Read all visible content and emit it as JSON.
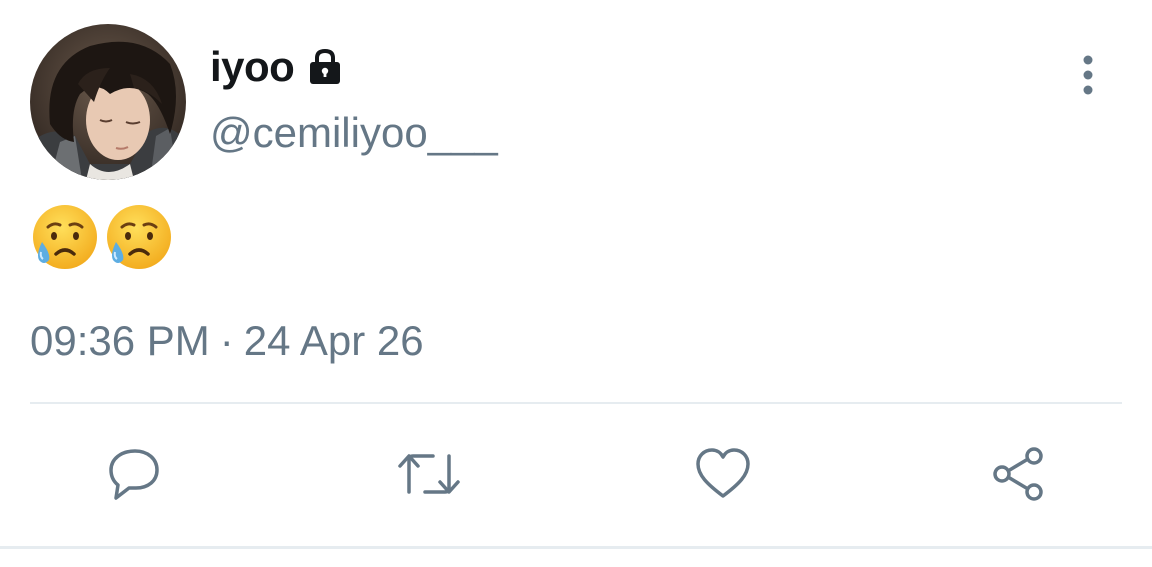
{
  "user": {
    "display_name": "iyoo",
    "handle": "@cemiliyoo___",
    "protected_icon": "lock-icon",
    "avatar": "profile-photo"
  },
  "tweet": {
    "emojis": [
      "sad-but-relieved-face",
      "sad-but-relieved-face"
    ],
    "time": "09:36 PM",
    "separator": "·",
    "date": "24 Apr 26"
  },
  "actions": [
    {
      "name": "reply",
      "icon": "reply-icon"
    },
    {
      "name": "retweet",
      "icon": "retweet-icon"
    },
    {
      "name": "like",
      "icon": "heart-icon"
    },
    {
      "name": "share",
      "icon": "share-icon"
    }
  ],
  "menu": {
    "icon": "more-vertical-icon"
  },
  "colors": {
    "text_primary": "#14171a",
    "text_secondary": "#657786",
    "divider": "#e6ecf0",
    "emoji_face": "#f7c22b",
    "emoji_tear": "#5dade2"
  }
}
